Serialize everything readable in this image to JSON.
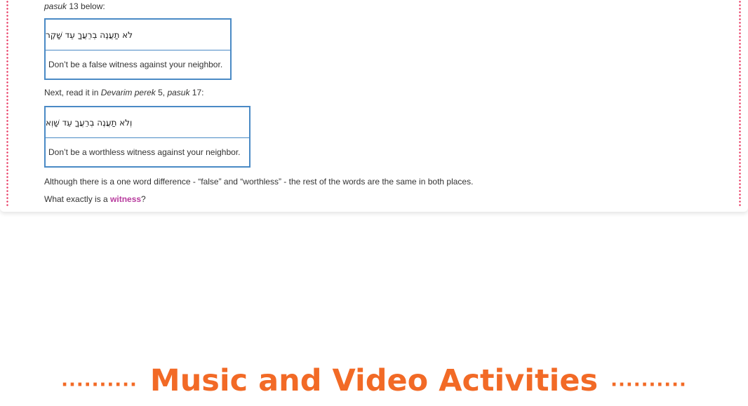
{
  "lesson": {
    "intro_italic": "pasuk",
    "intro_rest": " 13 below:",
    "verse1": {
      "hebrew": "לֹא תַעֲנֶה בְרֵעֲךָ עֵד שָׁקֶר",
      "english": "Don’t be a false witness against your neighbor."
    },
    "next_prefix": "Next, read it in ",
    "next_book": "Devarim",
    "next_perek_word": "perek",
    "next_mid": " 5, ",
    "next_pasuk_word": "pasuk",
    "next_suffix": " 17:",
    "verse2": {
      "hebrew": "וְלֹא תַעֲנֶה בְרֵעֲךָ עֵד שָׁוְא",
      "english": "Don’t be a worthless witness against your neighbor."
    },
    "comparison": "Although there is a one word difference - “false” and “worthless” - the rest of the words are the same in both places.",
    "question_prefix": "What exactly is a ",
    "question_link": "witness",
    "question_suffix": "?"
  },
  "banner": {
    "dots_left": "··········",
    "title": "Music and Video Activities",
    "dots_right": "··········"
  },
  "colors": {
    "accent_orange": "#f26a26",
    "border_dots": "#e8355f",
    "verse_border": "#4a8ac5",
    "link": "#b83c9e"
  }
}
